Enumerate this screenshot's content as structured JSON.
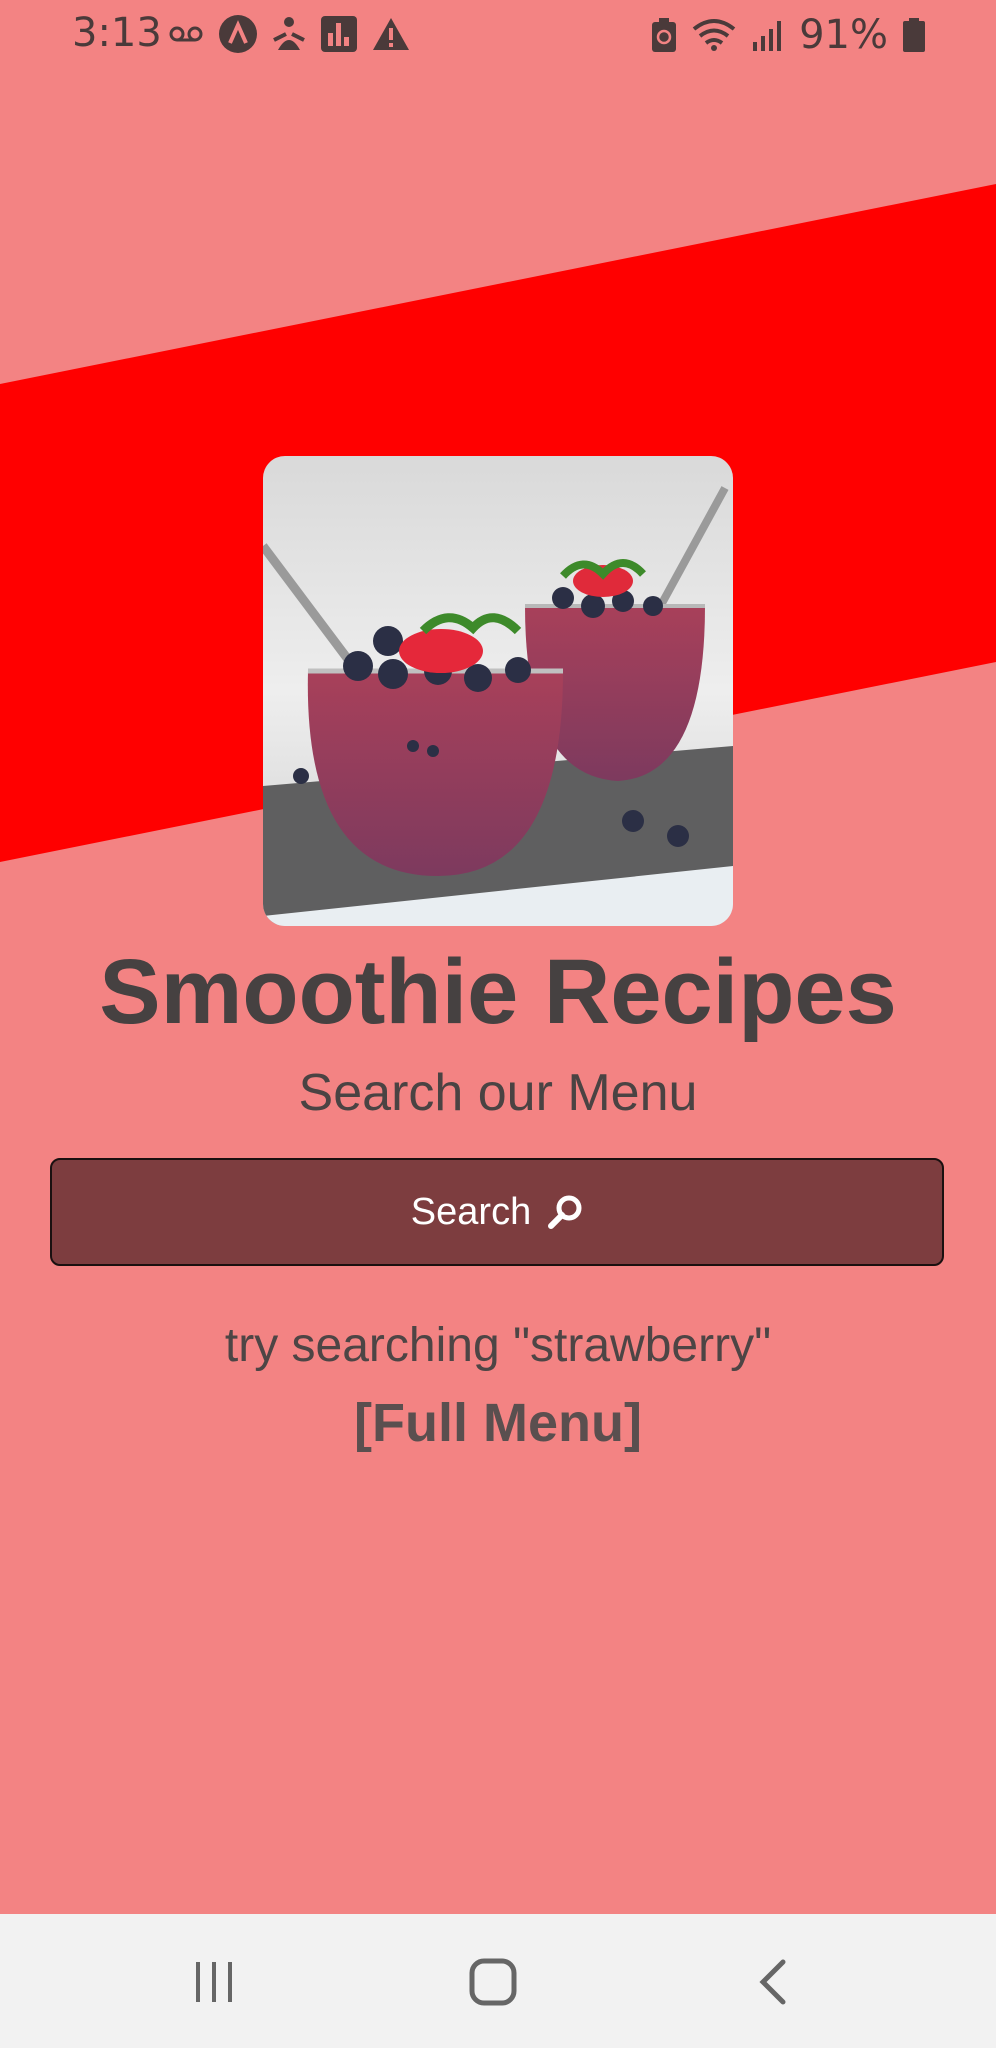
{
  "status_bar": {
    "time": "3:13",
    "battery_percent": "91%",
    "left_icons": [
      "voicemail-icon",
      "a-circle-icon",
      "meditation-icon",
      "bar-chart-icon",
      "warning-icon"
    ],
    "right_icons": [
      "battery-saver-icon",
      "wifi-icon",
      "signal-icon",
      "battery-icon"
    ]
  },
  "main": {
    "title": "Smoothie Recipes",
    "subtitle": "Search our Menu",
    "search_button_label": "Search",
    "hint": "try searching \"strawberry\"",
    "full_menu_link": "[Full Menu]"
  },
  "colors": {
    "background": "#f38383",
    "band": "#ff0000",
    "button": "#7d3d3f",
    "text": "#454040"
  },
  "nav_bar": {
    "buttons": [
      "recents-icon",
      "home-icon",
      "back-icon"
    ]
  }
}
